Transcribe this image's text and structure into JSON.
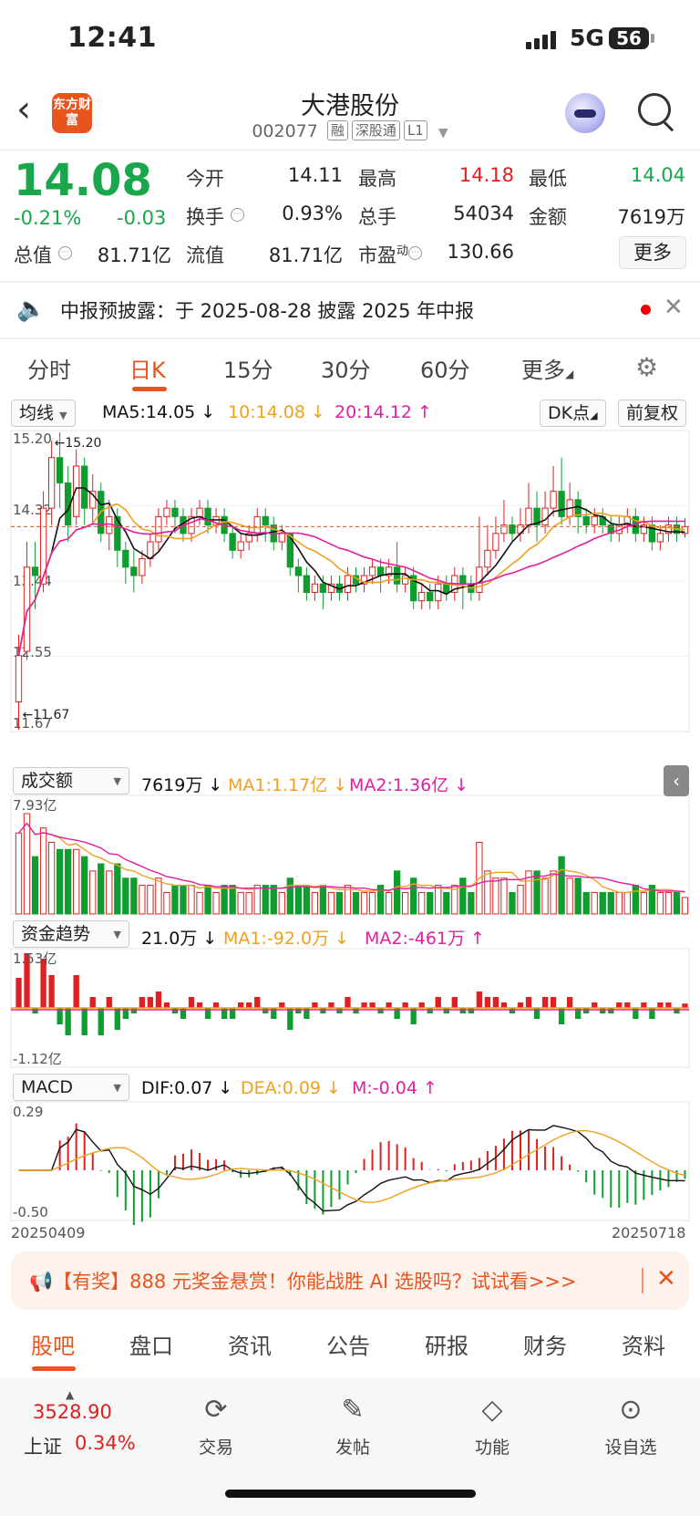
{
  "status_bar": {
    "time": "12:41",
    "network": "5G",
    "battery": "56"
  },
  "header": {
    "logo_text": "东方财富",
    "stock_name": "大港股份",
    "stock_code": "002077",
    "tags": [
      "融",
      "深股通",
      "L1"
    ]
  },
  "quote": {
    "price": "14.08",
    "change_pct": "-0.21%",
    "change_abs": "-0.03",
    "fields": [
      {
        "label": "今开",
        "value": "14.11",
        "color": "#222222"
      },
      {
        "label": "最高",
        "value": "14.18",
        "color": "#e02020"
      },
      {
        "label": "最低",
        "value": "14.04",
        "color": "#1aa64b"
      },
      {
        "label": "换手",
        "value": "0.93%",
        "color": "#222222"
      },
      {
        "label": "总手",
        "value": "54034",
        "color": "#222222"
      },
      {
        "label": "金额",
        "value": "7619万",
        "color": "#222222"
      },
      {
        "label": "总值",
        "value": "81.71亿",
        "color": "#222222"
      },
      {
        "label": "流值",
        "value": "81.71亿",
        "color": "#222222"
      },
      {
        "label": "市盈",
        "label_sup": "动",
        "value": "130.66",
        "color": "#222222"
      }
    ],
    "more_label": "更多"
  },
  "notice": {
    "text": "中报预披露：于 2025-08-28 披露 2025 年中报"
  },
  "period_tabs": [
    "分时",
    "日K",
    "15分",
    "30分",
    "60分",
    "更多"
  ],
  "active_period": "日K",
  "indicators": {
    "ma_selector": "均线",
    "ma5": "MA5:14.05 ↓",
    "ma10": "10:14.08 ↓",
    "ma20": "20:14.12 ↑",
    "dk_button": "DK点",
    "adjust_button": "前复权",
    "volume_selector": "成交额",
    "volume_value": "7619万 ↓",
    "volume_ma1": "MA1:1.17亿 ↓",
    "volume_ma2": "MA2:1.36亿 ↓",
    "fund_selector": "资金趋势",
    "fund_value": "21.0万 ↓",
    "fund_ma1": "MA1:-92.0万 ↓",
    "fund_ma2": "MA2:-461万 ↑",
    "macd_selector": "MACD",
    "dif": "DIF:0.07 ↓",
    "dea": "DEA:0.09 ↓",
    "m": "M:-0.04 ↑"
  },
  "colors": {
    "up": "#e02020",
    "down": "#0f9d2f",
    "accent": "#e8541e",
    "ma5": "#111111",
    "ma10": "#f0a020",
    "ma20": "#e020a0"
  },
  "chart_data": {
    "type": "candlestick",
    "date_start": "20250409",
    "date_end": "20250718",
    "price_axis_labels": [
      "15.20",
      "14.32",
      "13.44",
      "12.55",
      "11.67"
    ],
    "price_ylim": [
      11.67,
      15.2
    ],
    "high_marker": "15.20",
    "low_marker": "11.67",
    "last_close": 14.08,
    "candles": [
      [
        12.0,
        12.55,
        11.67,
        12.8
      ],
      [
        12.6,
        13.6,
        12.5,
        13.9
      ],
      [
        13.6,
        13.5,
        13.1,
        13.9
      ],
      [
        13.4,
        14.3,
        13.3,
        14.5
      ],
      [
        14.3,
        14.9,
        14.1,
        15.1
      ],
      [
        14.9,
        14.6,
        14.3,
        15.2
      ],
      [
        14.6,
        14.1,
        13.9,
        14.8
      ],
      [
        14.2,
        14.8,
        14.1,
        15.0
      ],
      [
        14.8,
        14.3,
        14.1,
        14.9
      ],
      [
        14.3,
        14.5,
        14.1,
        14.7
      ],
      [
        14.5,
        14.0,
        13.9,
        14.6
      ],
      [
        14.0,
        14.2,
        13.8,
        14.4
      ],
      [
        14.2,
        13.8,
        13.6,
        14.3
      ],
      [
        13.8,
        13.6,
        13.4,
        13.9
      ],
      [
        13.6,
        13.5,
        13.3,
        13.8
      ],
      [
        13.5,
        13.7,
        13.4,
        13.8
      ],
      [
        13.7,
        13.9,
        13.6,
        14.0
      ],
      [
        13.9,
        14.2,
        13.8,
        14.3
      ],
      [
        14.2,
        14.3,
        14.1,
        14.4
      ],
      [
        14.3,
        14.2,
        14.0,
        14.4
      ],
      [
        14.2,
        14.0,
        13.9,
        14.3
      ],
      [
        14.0,
        14.2,
        13.9,
        14.3
      ],
      [
        14.2,
        14.3,
        14.1,
        14.4
      ],
      [
        14.3,
        14.1,
        14.0,
        14.4
      ],
      [
        14.1,
        14.2,
        14.0,
        14.3
      ],
      [
        14.2,
        14.0,
        13.9,
        14.3
      ],
      [
        14.0,
        13.8,
        13.7,
        14.1
      ],
      [
        13.8,
        13.9,
        13.7,
        14.0
      ],
      [
        13.9,
        14.0,
        13.8,
        14.1
      ],
      [
        14.0,
        14.2,
        13.9,
        14.3
      ],
      [
        14.2,
        14.1,
        13.9,
        14.3
      ],
      [
        14.1,
        13.9,
        13.8,
        14.2
      ],
      [
        13.9,
        14.0,
        13.8,
        14.1
      ],
      [
        14.0,
        13.6,
        13.5,
        14.0
      ],
      [
        13.6,
        13.5,
        13.3,
        13.7
      ],
      [
        13.5,
        13.3,
        13.2,
        13.6
      ],
      [
        13.3,
        13.4,
        13.2,
        13.5
      ],
      [
        13.4,
        13.3,
        13.1,
        13.5
      ],
      [
        13.3,
        13.4,
        13.2,
        13.5
      ],
      [
        13.4,
        13.3,
        13.2,
        13.5
      ],
      [
        13.3,
        13.5,
        13.2,
        13.6
      ],
      [
        13.5,
        13.4,
        13.3,
        13.6
      ],
      [
        13.4,
        13.5,
        13.3,
        13.6
      ],
      [
        13.5,
        13.6,
        13.4,
        13.7
      ],
      [
        13.6,
        13.5,
        13.3,
        13.7
      ],
      [
        13.5,
        13.6,
        13.4,
        13.7
      ],
      [
        13.6,
        13.4,
        13.3,
        13.9
      ],
      [
        13.4,
        13.5,
        13.3,
        13.6
      ],
      [
        13.5,
        13.2,
        13.1,
        13.6
      ],
      [
        13.2,
        13.3,
        13.1,
        13.4
      ],
      [
        13.3,
        13.2,
        13.1,
        13.4
      ],
      [
        13.2,
        13.4,
        13.1,
        13.5
      ],
      [
        13.4,
        13.3,
        13.2,
        13.5
      ],
      [
        13.3,
        13.5,
        13.2,
        13.6
      ],
      [
        13.5,
        13.4,
        13.1,
        13.6
      ],
      [
        13.4,
        13.3,
        13.2,
        13.5
      ],
      [
        13.3,
        13.6,
        13.2,
        14.2
      ],
      [
        13.6,
        13.8,
        13.5,
        14.1
      ],
      [
        13.8,
        14.0,
        13.7,
        14.2
      ],
      [
        14.0,
        14.1,
        13.9,
        14.4
      ],
      [
        14.1,
        14.0,
        13.9,
        14.2
      ],
      [
        14.0,
        14.1,
        13.9,
        14.3
      ],
      [
        14.1,
        14.3,
        14.0,
        14.6
      ],
      [
        14.3,
        14.1,
        13.9,
        14.5
      ],
      [
        14.1,
        14.3,
        14.0,
        14.5
      ],
      [
        14.3,
        14.5,
        14.2,
        14.8
      ],
      [
        14.5,
        14.2,
        14.1,
        14.9
      ],
      [
        14.2,
        14.4,
        14.1,
        14.6
      ],
      [
        14.4,
        14.2,
        14.0,
        14.5
      ],
      [
        14.2,
        14.1,
        14.0,
        14.3
      ],
      [
        14.1,
        14.2,
        14.0,
        14.3
      ],
      [
        14.2,
        14.1,
        14.0,
        14.3
      ],
      [
        14.1,
        14.0,
        13.9,
        14.2
      ],
      [
        14.0,
        14.1,
        13.9,
        14.2
      ],
      [
        14.1,
        14.2,
        14.0,
        14.3
      ],
      [
        14.2,
        14.0,
        13.9,
        14.3
      ],
      [
        14.0,
        14.1,
        13.9,
        14.2
      ],
      [
        14.1,
        13.9,
        13.8,
        14.2
      ],
      [
        13.9,
        14.0,
        13.8,
        14.1
      ],
      [
        14.0,
        14.1,
        13.9,
        14.2
      ],
      [
        14.1,
        14.0,
        13.9,
        14.2
      ],
      [
        14.0,
        14.08,
        13.95,
        14.18
      ]
    ],
    "volume_axis_labels": [
      "7.93亿"
    ],
    "fund_axis_labels": [
      "1.53亿",
      "-1.12亿"
    ],
    "macd_axis_labels": [
      "0.29",
      "-0.50"
    ]
  },
  "promo": {
    "text": "【有奖】888 元奖金悬赏！你能战胜 AI 选股吗？试试看>>>"
  },
  "bottom_tabs": [
    "股吧",
    "盘口",
    "资讯",
    "公告",
    "研报",
    "财务",
    "资料"
  ],
  "active_bottom_tab": "股吧",
  "footer": {
    "index_value": "3528.90",
    "index_name": "上证",
    "index_change": "0.34%",
    "items": [
      {
        "label": "交易",
        "icon": "trade-icon"
      },
      {
        "label": "发帖",
        "icon": "post-icon"
      },
      {
        "label": "功能",
        "icon": "function-icon"
      },
      {
        "label": "设自选",
        "icon": "add-watchlist-icon"
      }
    ]
  }
}
